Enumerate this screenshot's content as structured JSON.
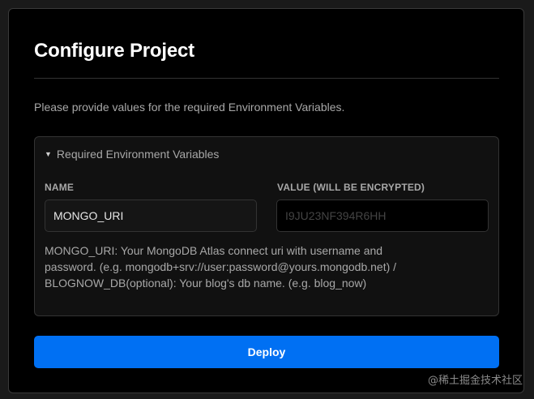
{
  "dialog": {
    "title": "Configure Project",
    "subtitle": "Please provide values for the required Environment Variables."
  },
  "env_section": {
    "summary_label": "Required Environment Variables",
    "expanded": true,
    "name_column_label": "NAME",
    "value_column_label": "VALUE (WILL BE ENCRYPTED)",
    "name_value": "MONGO_URI",
    "value_placeholder": "I9JU23NF394R6HH",
    "help_text": "MONGO_URI: Your MongoDB Atlas connect uri with username and password. (e.g. mongodb+srv://user:password@yours.mongodb.net) / BLOGNOW_DB(optional): Your blog's db name. (e.g. blog_now)"
  },
  "actions": {
    "deploy_label": "Deploy"
  },
  "watermark": "@稀土掘金技术社区",
  "colors": {
    "background": "#000000",
    "accent": "#0070f3",
    "border": "#333333",
    "text_muted": "#a8a8a8"
  },
  "icons": {
    "summary_caret": "caret-down-icon"
  }
}
